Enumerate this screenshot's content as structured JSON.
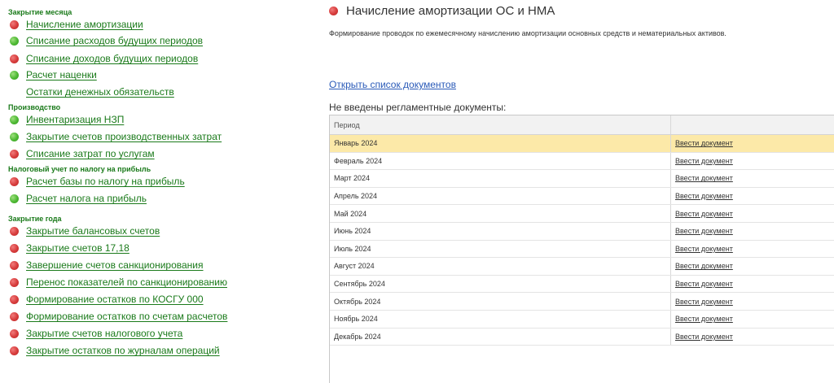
{
  "sidebar": {
    "sections": [
      {
        "title": "Закрытие месяца",
        "items": [
          {
            "label": "Начисление амортизации",
            "status": "red"
          },
          {
            "label": "Списание расходов будущих периодов",
            "status": "green"
          },
          {
            "label": "Списание доходов будущих периодов",
            "status": "red"
          },
          {
            "label": "Расчет наценки",
            "status": "green"
          },
          {
            "label": "Остатки денежных обязательств",
            "status": "none"
          }
        ]
      },
      {
        "title": "Производство",
        "items": [
          {
            "label": "Инвентаризация НЗП",
            "status": "green"
          },
          {
            "label": "Закрытие счетов производственных затрат",
            "status": "green"
          },
          {
            "label": "Списание затрат по услугам",
            "status": "red"
          }
        ]
      },
      {
        "title": "Налоговый учет по налогу на прибыль",
        "items": [
          {
            "label": "Расчет базы по налогу на прибыль",
            "status": "red"
          },
          {
            "label": "Расчет налога на прибыль",
            "status": "green"
          }
        ]
      },
      {
        "title": "Закрытие года",
        "items": [
          {
            "label": "Закрытие балансовых счетов",
            "status": "red"
          },
          {
            "label": "Закрытие  счетов 17,18",
            "status": "red"
          },
          {
            "label": "Завершение счетов санкционирования",
            "status": "red"
          },
          {
            "label": "Перенос показателей по санкционированию",
            "status": "red"
          },
          {
            "label": "Формирование остатков по КОСГУ 000",
            "status": "red"
          },
          {
            "label": "Формирование остатков по счетам расчетов",
            "status": "red"
          },
          {
            "label": "Закрытие счетов налогового учета",
            "status": "red"
          },
          {
            "label": "Закрытие остатков по журналам операций",
            "status": "red"
          }
        ]
      }
    ]
  },
  "main": {
    "title": "Начисление амортизации ОС и НМА",
    "title_status": "red",
    "description": "Формирование проводок по ежемесячному начислению амортизации основных средств и нематериальных активов.",
    "open_list_link": "Открыть список документов",
    "not_entered_label": "Не введены регламентные документы:",
    "table": {
      "headers": [
        "Период",
        ""
      ],
      "rows": [
        {
          "period": "Январь 2024",
          "action": "Ввести документ",
          "selected": true
        },
        {
          "period": "Февраль 2024",
          "action": "Ввести документ"
        },
        {
          "period": "Март 2024",
          "action": "Ввести документ"
        },
        {
          "period": "Апрель 2024",
          "action": "Ввести документ"
        },
        {
          "period": "Май 2024",
          "action": "Ввести документ"
        },
        {
          "period": "Июнь 2024",
          "action": "Ввести документ"
        },
        {
          "period": "Июль 2024",
          "action": "Ввести документ"
        },
        {
          "period": "Август 2024",
          "action": "Ввести документ"
        },
        {
          "period": "Сентябрь 2024",
          "action": "Ввести документ"
        },
        {
          "period": "Октябрь 2024",
          "action": "Ввести документ"
        },
        {
          "period": "Ноябрь 2024",
          "action": "Ввести документ"
        },
        {
          "period": "Декабрь 2024",
          "action": "Ввести документ"
        }
      ]
    }
  },
  "colors": {
    "section_title": "#1a7a1a",
    "link_green": "#1a7a1a",
    "link_blue": "#2a5ab8",
    "status_red": "#d63b3b",
    "status_green": "#4db833",
    "selected_row": "#fce9a8"
  }
}
